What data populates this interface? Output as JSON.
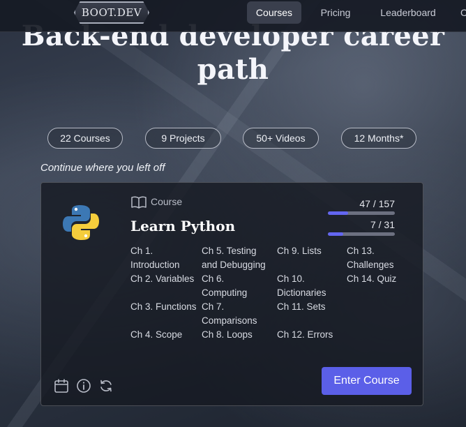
{
  "nav": {
    "logo_text": "BOOT.DEV",
    "items": [
      {
        "label": "Courses",
        "active": true
      },
      {
        "label": "Pricing",
        "active": false
      },
      {
        "label": "Leaderboard",
        "active": false
      },
      {
        "label": "C",
        "active": false
      }
    ]
  },
  "hero": {
    "line1": "Back-end developer career",
    "line2": "path"
  },
  "stats": [
    "22 Courses",
    "9 Projects",
    "50+ Videos",
    "12 Months*"
  ],
  "continue_label": "Continue where you left off",
  "course": {
    "kind_label": "Course",
    "kind_icon": "book-icon",
    "logo_icon": "python-logo",
    "title": "Learn Python",
    "progress": [
      {
        "text": "47 / 157",
        "fraction": 0.3
      },
      {
        "text": "7 / 31",
        "fraction": 0.23
      }
    ],
    "chapter_columns": [
      [
        "Ch 1. Introduction",
        "Ch 2. Variables",
        "Ch 3. Functions",
        "Ch 4. Scope"
      ],
      [
        "Ch 5. Testing and Debugging",
        "Ch 6. Computing",
        "Ch 7. Comparisons",
        "Ch 8. Loops"
      ],
      [
        "Ch 9. Lists",
        "Ch 10. Dictionaries",
        "Ch 11. Sets",
        "Ch 12. Errors"
      ],
      [
        "Ch 13. Challenges",
        "Ch 14. Quiz"
      ]
    ],
    "footer_icons": [
      "calendar-icon",
      "info-icon",
      "refresh-icon"
    ],
    "enter_label": "Enter Course"
  },
  "colors": {
    "accent": "#5b5fe8",
    "progress_fill": "#6366f1"
  }
}
